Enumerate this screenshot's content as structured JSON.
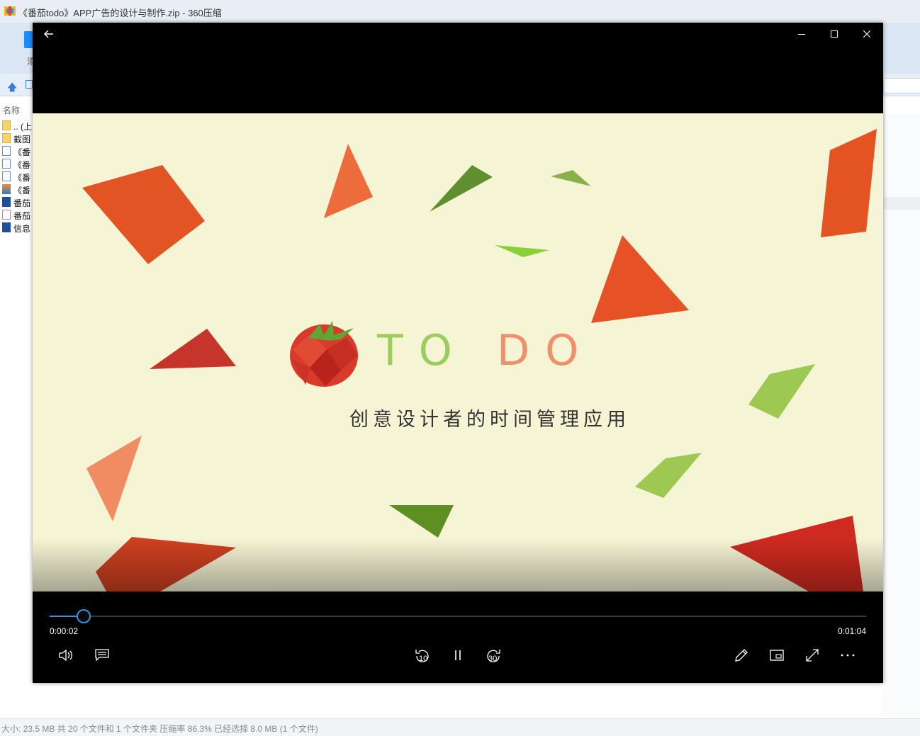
{
  "background_window": {
    "title": "《番茄todo》APP广告的设计与制作.zip - 360压缩",
    "toolbar_char": "添",
    "column_header": "名称",
    "files": [
      {
        "name": ".. (上",
        "icon": "folder-icon"
      },
      {
        "name": "截图",
        "icon": "folder-icon"
      },
      {
        "name": "《番",
        "icon": "document-icon"
      },
      {
        "name": "《番",
        "icon": "document-icon"
      },
      {
        "name": "《番",
        "icon": "document-icon"
      },
      {
        "name": "《番",
        "icon": "image-icon"
      },
      {
        "name": "番茄",
        "icon": "executable-icon"
      },
      {
        "name": "番茄",
        "icon": "blank-file-icon"
      },
      {
        "name": "信息",
        "icon": "program-icon"
      }
    ],
    "status": "大小: 23.5 MB 共 20 个文件和 1 个文件夹 压缩率 86.3% 已经选择 8.0 MB (1 个文件)"
  },
  "player": {
    "video": {
      "logo_part1": "TO",
      "logo_part2": "DO",
      "tagline": "创意设计者的时间管理应用"
    },
    "playback": {
      "current_time": "0:00:02",
      "total_time": "0:01:04",
      "progress_fraction": 0.042
    },
    "controls": {
      "skip_back_seconds": "10",
      "skip_forward_seconds": "30"
    },
    "colors": {
      "accent": "#3d8fe0",
      "video_bg": "#f5f4d4",
      "logo_green": "#9ccb5e",
      "logo_orange": "#ef8f6c"
    }
  }
}
